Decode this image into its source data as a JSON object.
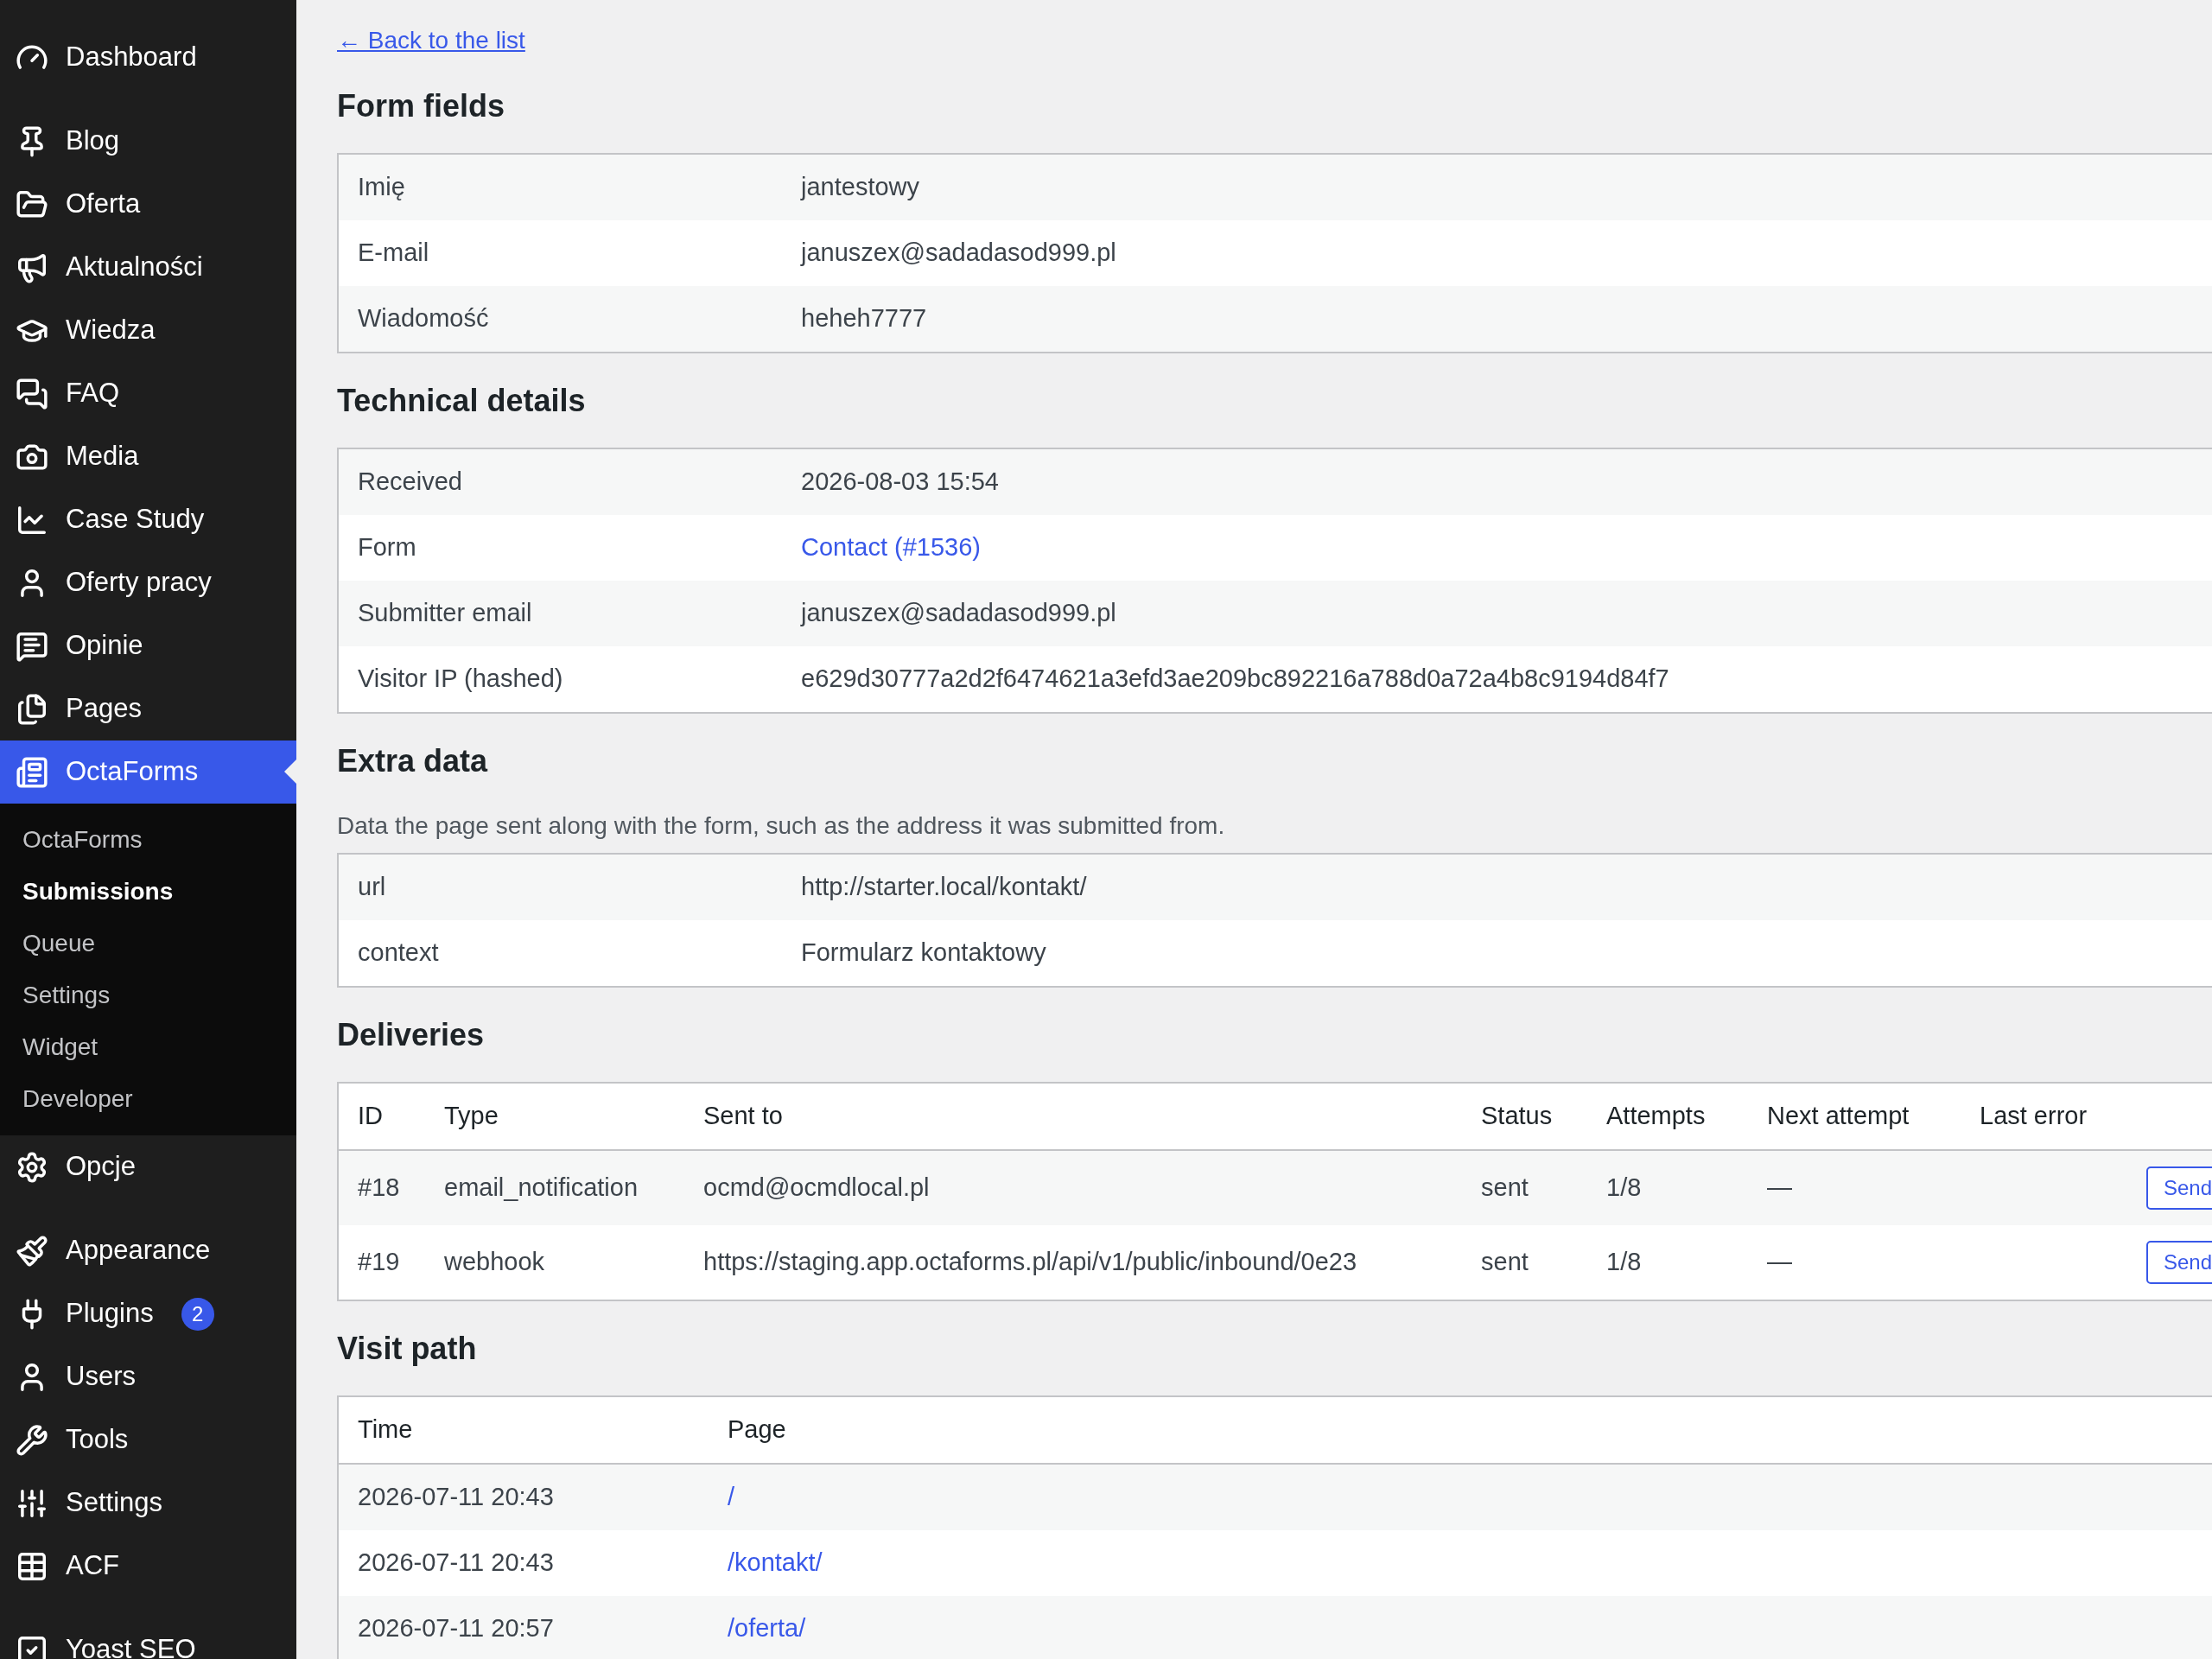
{
  "sidebar": {
    "groups": [
      [
        {
          "label": "Dashboard",
          "selected": false
        }
      ],
      [
        {
          "label": "Blog",
          "selected": false
        },
        {
          "label": "Oferta",
          "selected": false
        },
        {
          "label": "Aktualności",
          "selected": false
        },
        {
          "label": "Wiedza",
          "selected": false
        },
        {
          "label": "FAQ",
          "selected": false
        },
        {
          "label": "Media",
          "selected": false
        },
        {
          "label": "Case Study",
          "selected": false
        },
        {
          "label": "Oferty pracy",
          "selected": false
        },
        {
          "label": "Opinie",
          "selected": false
        },
        {
          "label": "Pages",
          "selected": false
        },
        {
          "label": "OctaForms",
          "selected": true,
          "children": [
            {
              "label": "OctaForms",
              "selected": false
            },
            {
              "label": "Submissions",
              "selected": true
            },
            {
              "label": "Queue",
              "selected": false
            },
            {
              "label": "Settings",
              "selected": false
            },
            {
              "label": "Widget",
              "selected": false
            },
            {
              "label": "Developer",
              "selected": false
            }
          ]
        },
        {
          "label": "Opcje",
          "selected": false
        }
      ],
      [
        {
          "label": "Appearance",
          "selected": false
        },
        {
          "label": "Plugins",
          "selected": false,
          "badge": "2"
        },
        {
          "label": "Users",
          "selected": false
        },
        {
          "label": "Tools",
          "selected": false
        },
        {
          "label": "Settings",
          "selected": false
        },
        {
          "label": "ACF",
          "selected": false
        }
      ],
      [
        {
          "label": "Yoast SEO",
          "selected": false
        }
      ]
    ]
  },
  "back_link": "← Back to the list",
  "sections": [
    {
      "kind": "pairs",
      "title": "Form fields",
      "rows": [
        {
          "label": "Imię",
          "value": "jantestowy"
        },
        {
          "label": "E-mail",
          "value": "januszex@sadadasod999.pl"
        },
        {
          "label": "Wiadomość",
          "value": "heheh7777"
        }
      ]
    },
    {
      "kind": "pairs",
      "title": "Technical details",
      "rows": [
        {
          "label": "Received",
          "value": "2026-08-03 15:54"
        },
        {
          "label": "Form",
          "value": "Contact (#1536)",
          "link": true
        },
        {
          "label": "Submitter email",
          "value": "januszex@sadadasod999.pl"
        },
        {
          "label": "Visitor IP (hashed)",
          "value": "e629d30777a2d2f6474621a3efd3ae209bc892216a788d0a72a4b8c9194d84f7"
        }
      ]
    },
    {
      "kind": "pairs",
      "title": "Extra data",
      "description": "Data the page sent along with the form, such as the address it was submitted from.",
      "rows": [
        {
          "label": "url",
          "value": "http://starter.local/kontakt/"
        },
        {
          "label": "context",
          "value": "Formularz kontaktowy"
        }
      ]
    },
    {
      "kind": "deliveries",
      "title": "Deliveries",
      "columns": [
        "ID",
        "Type",
        "Sent to",
        "Status",
        "Attempts",
        "Next attempt",
        "Last error"
      ],
      "rows": [
        {
          "cells": [
            "#18",
            "email_notification",
            "ocmd@ocmdlocal.pl",
            "sent",
            "1/8",
            "—",
            ""
          ],
          "action": "Send"
        },
        {
          "cells": [
            "#19",
            "webhook",
            "https://staging.app.octaforms.pl/api/v1/public/inbound/0e23",
            "sent",
            "1/8",
            "—",
            ""
          ],
          "action": "Send"
        }
      ]
    },
    {
      "kind": "visits",
      "title": "Visit path",
      "columns": [
        "Time",
        "Page"
      ],
      "rows": [
        {
          "time": "2026-07-11 20:43",
          "page": "/"
        },
        {
          "time": "2026-07-11 20:43",
          "page": "/kontakt/"
        },
        {
          "time": "2026-07-11 20:57",
          "page": "/oferta/"
        }
      ]
    }
  ]
}
